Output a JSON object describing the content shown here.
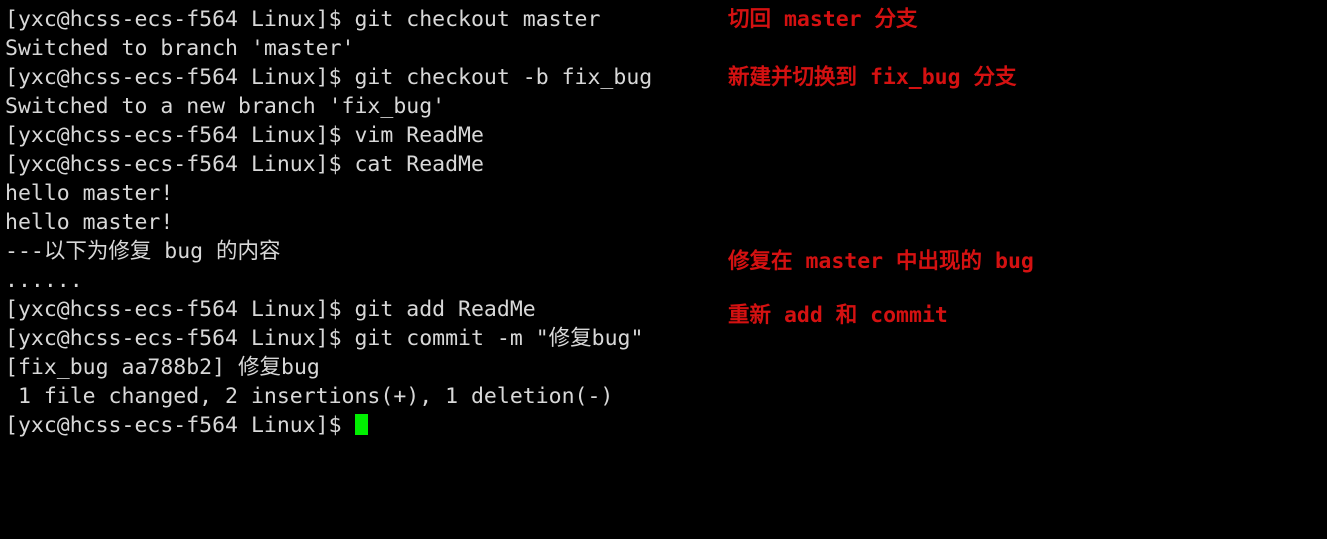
{
  "terminal": {
    "prompt": "[yxc@hcss-ecs-f564 Linux]$ ",
    "background_color": "#000000",
    "foreground_color": "#d8d8d8",
    "cursor_color": "#00ef00",
    "annotation_color": "#d41111",
    "lines": [
      {
        "id": "line-1",
        "text": "[yxc@hcss-ecs-f564 Linux]$ git checkout master",
        "kind": "prompt-command"
      },
      {
        "id": "line-2",
        "text": "Switched to branch 'master'",
        "kind": "output"
      },
      {
        "id": "line-3",
        "text": "[yxc@hcss-ecs-f564 Linux]$ git checkout -b fix_bug",
        "kind": "prompt-command"
      },
      {
        "id": "line-4",
        "text": "Switched to a new branch 'fix_bug'",
        "kind": "output"
      },
      {
        "id": "line-5",
        "text": "[yxc@hcss-ecs-f564 Linux]$ vim ReadMe",
        "kind": "prompt-command"
      },
      {
        "id": "line-6",
        "text": "[yxc@hcss-ecs-f564 Linux]$ cat ReadMe",
        "kind": "prompt-command"
      },
      {
        "id": "line-7",
        "text": "hello master!",
        "kind": "output"
      },
      {
        "id": "line-8",
        "text": "hello master!",
        "kind": "output"
      },
      {
        "id": "line-9",
        "text": "---以下为修复 bug 的内容",
        "kind": "output"
      },
      {
        "id": "line-10",
        "text": "......",
        "kind": "output"
      },
      {
        "id": "line-11",
        "text": "[yxc@hcss-ecs-f564 Linux]$ git add ReadMe",
        "kind": "prompt-command"
      },
      {
        "id": "line-12",
        "text": "[yxc@hcss-ecs-f564 Linux]$ git commit -m \"修复bug\"",
        "kind": "prompt-command"
      },
      {
        "id": "line-13",
        "text": "[fix_bug aa788b2] 修复bug",
        "kind": "output"
      },
      {
        "id": "line-14",
        "text": " 1 file changed, 2 insertions(+), 1 deletion(-)",
        "kind": "output"
      },
      {
        "id": "line-15",
        "text": "[yxc@hcss-ecs-f564 Linux]$ ",
        "kind": "prompt-active"
      }
    ]
  },
  "annotations": [
    {
      "id": "annotation-checkout-master",
      "text": "切回 master 分支"
    },
    {
      "id": "annotation-new-branch",
      "text": "新建并切换到 fix_bug 分支"
    },
    {
      "id": "annotation-fix-bug",
      "text": "修复在 master 中出现的 bug"
    },
    {
      "id": "annotation-add-commit",
      "text": "重新 add 和 commit"
    }
  ],
  "commit": {
    "branch": "fix_bug",
    "hash": "aa788b2",
    "message": "修复bug",
    "files_changed": 1,
    "insertions": 2,
    "deletions": 1
  }
}
